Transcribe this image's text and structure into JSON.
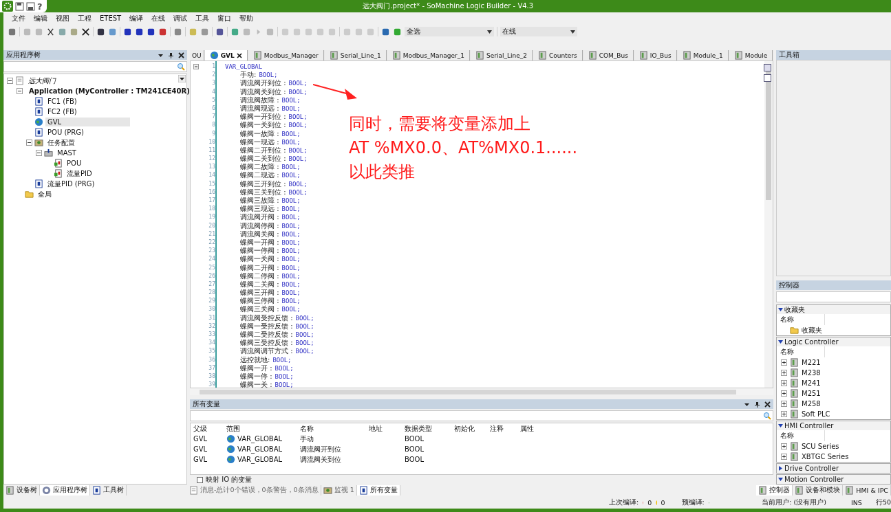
{
  "window": {
    "title": "远大阀门.project* - SoMachine Logic Builder - V4.3",
    "quick_help": "?"
  },
  "menu": [
    "文件",
    "编辑",
    "视图",
    "工程",
    "ETEST",
    "编译",
    "在线",
    "调试",
    "工具",
    "窗口",
    "帮助"
  ],
  "toolbar": {
    "filter": "全选",
    "mode": "在线"
  },
  "app_tree": {
    "title": "应用程序树",
    "nodes": [
      {
        "label": "远大阀门",
        "kind": "project",
        "expanded": true,
        "selected": false,
        "children": [
          {
            "label": "Application (MyController : TM241CE40R)",
            "kind": "app",
            "expanded": true,
            "selected": false,
            "children": [
              {
                "label": "FC1 (FB)",
                "kind": "pou",
                "selected": false
              },
              {
                "label": "FC2 (FB)",
                "kind": "pou",
                "selected": false
              },
              {
                "label": "GVL",
                "kind": "globe",
                "selected": true
              },
              {
                "label": "POU (PRG)",
                "kind": "pou",
                "selected": false
              },
              {
                "label": "任务配置",
                "kind": "task",
                "expanded": true,
                "selected": false,
                "children": [
                  {
                    "label": "MAST",
                    "kind": "mast",
                    "expanded": true,
                    "selected": false,
                    "children": [
                      {
                        "label": "POU",
                        "kind": "call",
                        "selected": false
                      },
                      {
                        "label": "流量PID",
                        "kind": "call",
                        "selected": false
                      }
                    ]
                  }
                ]
              },
              {
                "label": "流量PID (PRG)",
                "kind": "pou",
                "selected": false
              }
            ]
          },
          {
            "label": "全局",
            "kind": "folder",
            "selected": false
          }
        ]
      }
    ]
  },
  "left_tabs": [
    {
      "label": "设备树",
      "selected": false
    },
    {
      "label": "应用程序树",
      "selected": true
    },
    {
      "label": "工具树",
      "selected": false
    }
  ],
  "editor_tabs": [
    {
      "label": "OU",
      "selected": false
    },
    {
      "label": "GVL",
      "selected": true
    },
    {
      "label": "Modbus_Manager",
      "selected": false
    },
    {
      "label": "Serial_Line_1",
      "selected": false
    },
    {
      "label": "Modbus_Manager_1",
      "selected": false
    },
    {
      "label": "Serial_Line_2",
      "selected": false
    },
    {
      "label": "Counters",
      "selected": false
    },
    {
      "label": "COM_Bus",
      "selected": false
    },
    {
      "label": "IO_Bus",
      "selected": false
    },
    {
      "label": "Module_1",
      "selected": false
    },
    {
      "label": "Module",
      "selected": false
    }
  ],
  "code": [
    {
      "n": "1",
      "keyword": "VAR_GLOBAL"
    },
    {
      "n": "2",
      "name": "手动:",
      "type": "BOOL;"
    },
    {
      "n": "3",
      "name": "调流阀开到位 :",
      "type": "BOOL;"
    },
    {
      "n": "4",
      "name": "调流阀关到位 :",
      "type": "BOOL;"
    },
    {
      "n": "5",
      "name": "调流阀故障 :",
      "type": "BOOL;"
    },
    {
      "n": "6",
      "name": "调流阀现远 :",
      "type": "BOOL;"
    },
    {
      "n": "7",
      "name": "蝶阀一开到位 :",
      "type": "BOOL;"
    },
    {
      "n": "8",
      "name": "蝶阀一关到位 :",
      "type": "BOOL;"
    },
    {
      "n": "9",
      "name": "蝶阀一故障 :",
      "type": "BOOL;"
    },
    {
      "n": "10",
      "name": "蝶阀一现远 :",
      "type": "BOOL;"
    },
    {
      "n": "11",
      "name": "蝶阀二开到位 :",
      "type": "BOOL;"
    },
    {
      "n": "12",
      "name": "蝶阀二关到位 :",
      "type": "BOOL;"
    },
    {
      "n": "13",
      "name": "蝶阀二故障 :",
      "type": "BOOL;"
    },
    {
      "n": "14",
      "name": "蝶阀二现远 :",
      "type": "BOOL;"
    },
    {
      "n": "15",
      "name": "蝶阀三开到位 :",
      "type": "BOOL;"
    },
    {
      "n": "16",
      "name": "蝶阀三关到位 :",
      "type": "BOOL;"
    },
    {
      "n": "17",
      "name": "蝶阀三故障 :",
      "type": "BOOL;"
    },
    {
      "n": "18",
      "name": "蝶阀三现远 :",
      "type": "BOOL;"
    },
    {
      "n": "19",
      "name": "调流阀开阀 :",
      "type": "BOOL;"
    },
    {
      "n": "20",
      "name": "调流阀停阀 :",
      "type": "BOOL;"
    },
    {
      "n": "21",
      "name": "调流阀关阀 :",
      "type": "BOOL;"
    },
    {
      "n": "22",
      "name": "蝶阀一开阀 :",
      "type": "BOOL;"
    },
    {
      "n": "23",
      "name": "蝶阀一停阀 :",
      "type": "BOOL;"
    },
    {
      "n": "24",
      "name": "蝶阀一关阀 :",
      "type": "BOOL;"
    },
    {
      "n": "25",
      "name": "蝶阀二开阀 :",
      "type": "BOOL;"
    },
    {
      "n": "26",
      "name": "蝶阀二停阀 :",
      "type": "BOOL;"
    },
    {
      "n": "27",
      "name": "蝶阀二关阀 :",
      "type": "BOOL;"
    },
    {
      "n": "28",
      "name": "蝶阀三开阀 :",
      "type": "BOOL;"
    },
    {
      "n": "29",
      "name": "蝶阀三停阀 :",
      "type": "BOOL;"
    },
    {
      "n": "30",
      "name": "蝶阀三关阀 :",
      "type": "BOOL;"
    },
    {
      "n": "31",
      "name": "调流阀受控反馈 :",
      "type": "BOOL;"
    },
    {
      "n": "32",
      "name": "蝶阀一受控反馈 :",
      "type": "BOOL;"
    },
    {
      "n": "33",
      "name": "蝶阀二受控反馈 :",
      "type": "BOOL;"
    },
    {
      "n": "34",
      "name": "蝶阀三受控反馈 :",
      "type": "BOOL;"
    },
    {
      "n": "35",
      "name": "调流阀调节方式 :",
      "type": "BOOL;"
    },
    {
      "n": "36",
      "name": "远控就地:",
      "type": "BOOL;"
    },
    {
      "n": "37",
      "name": "蝶阀一开 :",
      "type": "BOOL;"
    },
    {
      "n": "38",
      "name": "蝶阀一停 :",
      "type": "BOOL;"
    },
    {
      "n": "39",
      "name": "蝶阀一关 :",
      "type": "BOOL;"
    }
  ],
  "annotation": {
    "lines": [
      "同时，需要将变量添加上",
      "AT %MX0.0、AT%MX0.1......",
      "以此类推"
    ]
  },
  "variables": {
    "title": "所有变量",
    "columns": [
      "父级",
      "范围",
      "名称",
      "地址",
      "数据类型",
      "初始化",
      "注释",
      "属性"
    ],
    "rows": [
      {
        "parent": "GVL",
        "scope": "VAR_GLOBAL",
        "name": "手动",
        "type": "BOOL"
      },
      {
        "parent": "GVL",
        "scope": "VAR_GLOBAL",
        "name": "调流阀开到位",
        "type": "BOOL"
      },
      {
        "parent": "GVL",
        "scope": "VAR_GLOBAL",
        "name": "调流阀关到位",
        "type": "BOOL"
      }
    ],
    "map_io": {
      "label": "映射 IO 的变量",
      "checked": false
    }
  },
  "bottom_tabs": [
    {
      "label": "消息-总计0个错误，0条警告，0条消息",
      "kind": "messages",
      "selected": false
    },
    {
      "label": "监视 1",
      "kind": "watch",
      "selected": false
    },
    {
      "label": "所有变量",
      "kind": "vars",
      "selected": true
    }
  ],
  "toolbox": {
    "title": "工具箱"
  },
  "controllers": {
    "title": "控制器",
    "sections": [
      {
        "title": "收藏夹",
        "expanded": true,
        "column": "名称",
        "items": [
          {
            "label": "收藏夹",
            "kind": "folder"
          }
        ]
      },
      {
        "title": "Logic Controller",
        "expanded": true,
        "column": "名称",
        "items": [
          {
            "label": "M221",
            "kind": "device"
          },
          {
            "label": "M238",
            "kind": "device"
          },
          {
            "label": "M241",
            "kind": "device"
          },
          {
            "label": "M251",
            "kind": "device"
          },
          {
            "label": "M258",
            "kind": "device"
          },
          {
            "label": "Soft PLC",
            "kind": "device"
          }
        ]
      },
      {
        "title": "HMI Controller",
        "expanded": true,
        "column": "名称",
        "items": [
          {
            "label": "SCU Series",
            "kind": "device"
          },
          {
            "label": "XBTGC Series",
            "kind": "device"
          }
        ]
      },
      {
        "title": "Drive Controller",
        "expanded": false
      },
      {
        "title": "Motion Controller",
        "expanded": true
      }
    ]
  },
  "right_tabs": [
    {
      "label": "控制器",
      "selected": true
    },
    {
      "label": "设备和模块",
      "selected": false
    },
    {
      "label": "HMI & IPC",
      "selected": false
    }
  ],
  "status": {
    "last_build": "上次编译:",
    "errors": "0",
    "warnings": "0",
    "precompile": "预编译:",
    "user": "当前用户: (没有用户)",
    "ins": "INS",
    "line": "行50"
  }
}
